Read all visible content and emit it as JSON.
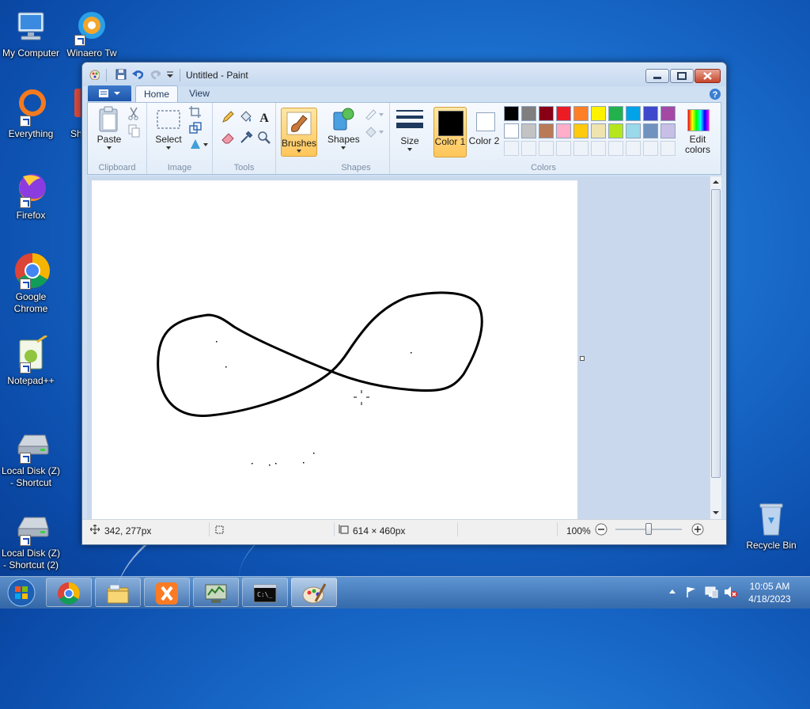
{
  "desktop": {
    "icons": [
      {
        "label": "My Computer"
      },
      {
        "label": "Winaero Tw"
      },
      {
        "label": "Everything"
      },
      {
        "label": "Sh"
      },
      {
        "label": "Firefox"
      },
      {
        "label": "Google Chrome"
      },
      {
        "label": "Notepad++"
      },
      {
        "label": "Local Disk (Z) - Shortcut"
      },
      {
        "label": "Local Disk (Z) - Shortcut (2)"
      },
      {
        "label": "Recycle Bin"
      }
    ]
  },
  "window": {
    "title": "Untitled - Paint",
    "tabs": [
      {
        "label": "Home",
        "active": true
      },
      {
        "label": "View",
        "active": false
      }
    ],
    "ribbon": {
      "groups": {
        "clipboard": "Clipboard",
        "image": "Image",
        "tools": "Tools",
        "shapes": "Shapes",
        "colors": "Colors"
      },
      "paste_label": "Paste",
      "select_label": "Select",
      "brushes_label": "Brushes",
      "shapes_label": "Shapes",
      "size_label": "Size",
      "color1_label": "Color 1",
      "color2_label": "Color 2",
      "edit_colors_label": "Edit colors"
    },
    "palette": {
      "row1": [
        "#000000",
        "#7f7f7f",
        "#880015",
        "#ed1c24",
        "#ff7f27",
        "#fff200",
        "#22b14c",
        "#00a2e8",
        "#3f48cc",
        "#a349a4"
      ],
      "row2": [
        "#ffffff",
        "#c3c3c3",
        "#b97a57",
        "#ffaec9",
        "#ffc90e",
        "#efe4b0",
        "#b5e61d",
        "#99d9ea",
        "#7092be",
        "#c8bfe7"
      ]
    },
    "color1": "#000000",
    "color2": "#ffffff",
    "status": {
      "cursor_pos": "342, 277px",
      "canvas_size": "614 × 460px",
      "zoom": "100%"
    }
  },
  "taskbar": {
    "time": "10:05 AM",
    "date": "4/18/2023",
    "apps": [
      "chrome-icon",
      "file-explorer-icon",
      "xampp-icon",
      "network-monitor-icon",
      "cmd-icon",
      "paint-icon"
    ]
  }
}
